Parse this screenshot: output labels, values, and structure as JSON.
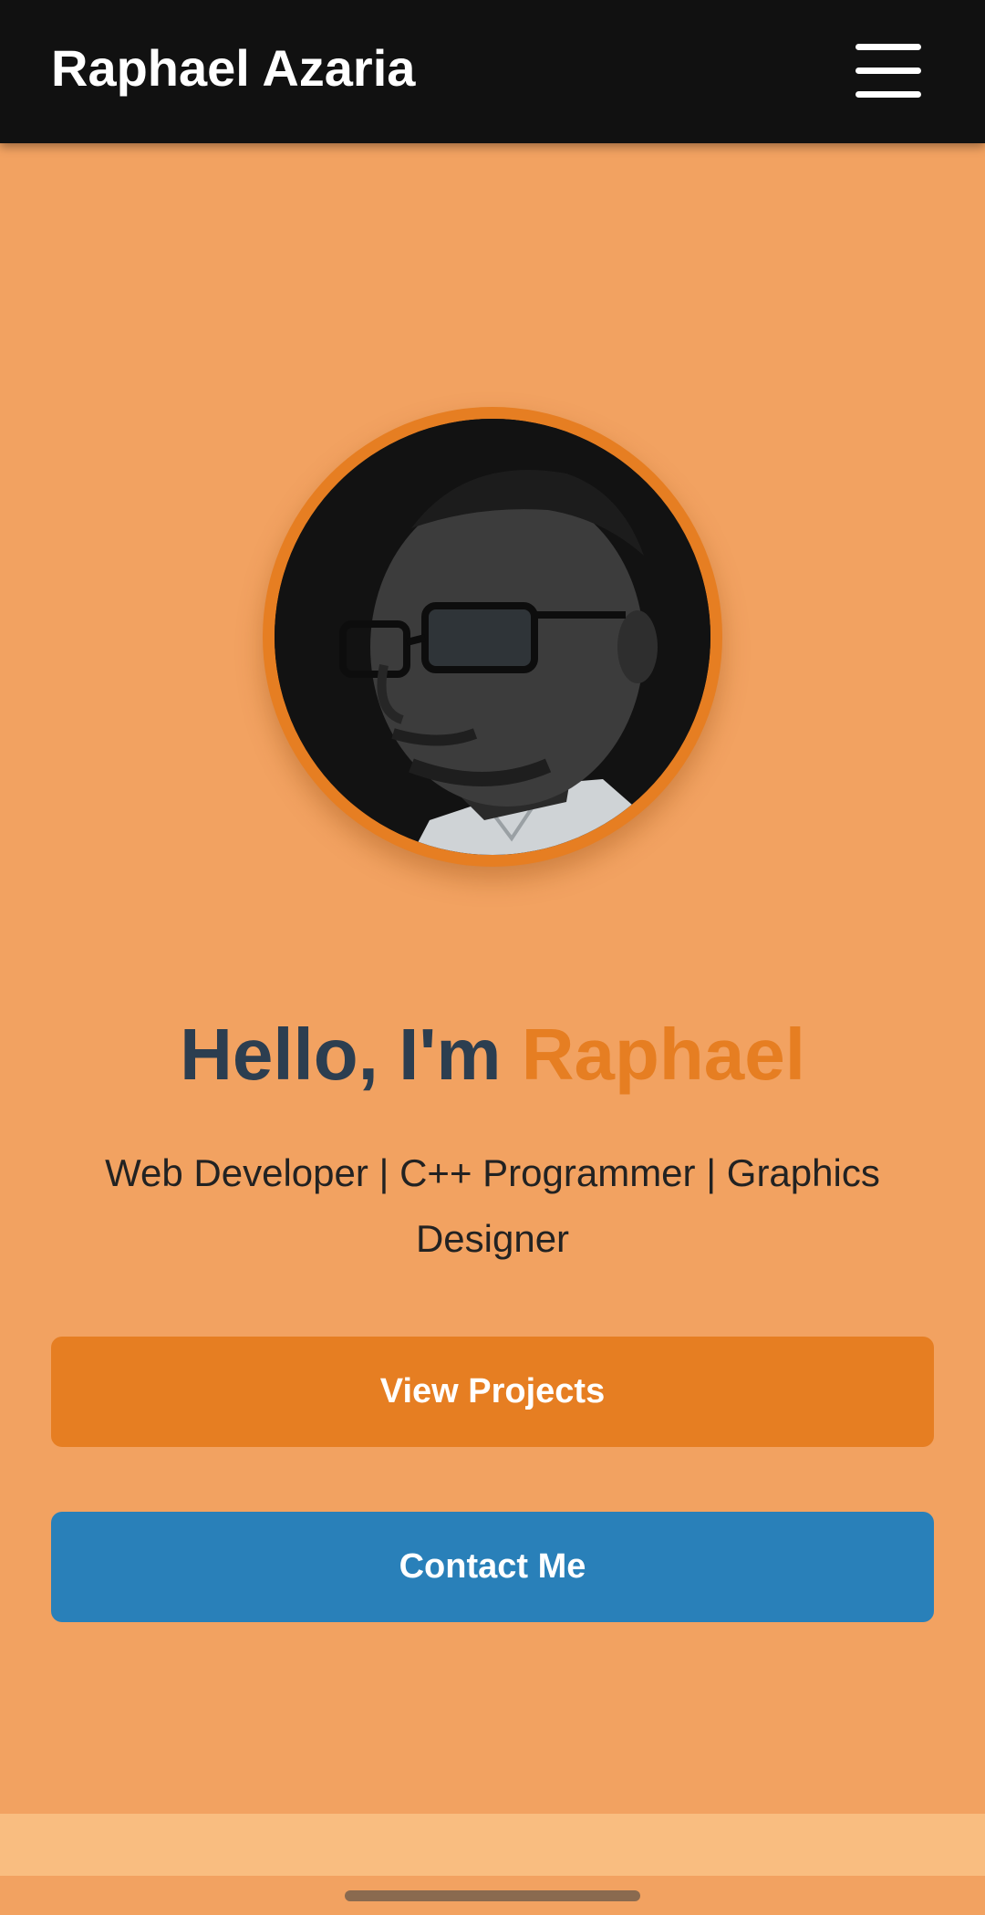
{
  "header": {
    "brand": "Raphael Azaria"
  },
  "hero": {
    "greeting_prefix": "Hello, I'm ",
    "greeting_name": "Raphael",
    "subtitle": "Web Developer | C++ Programmer | Graphics Designer"
  },
  "actions": {
    "view_projects": "View Projects",
    "contact_me": "Contact Me"
  },
  "icons": {
    "menu": "hamburger-menu-icon",
    "profile": "profile-photo"
  },
  "colors": {
    "background": "#f2a261",
    "header_bg": "#111111",
    "accent": "#e67e22",
    "heading_dark": "#2c3e50",
    "contact_button": "#2980b9",
    "footer_band": "#f9bd80"
  }
}
